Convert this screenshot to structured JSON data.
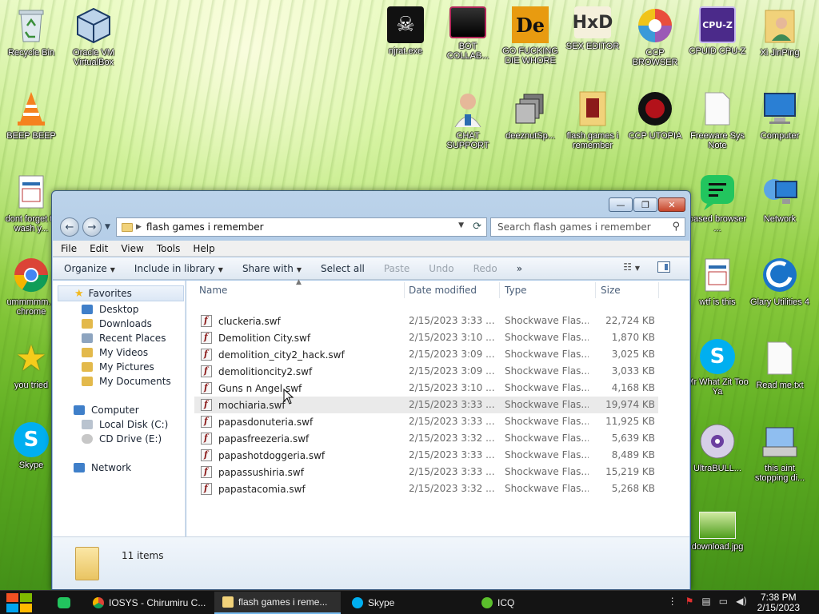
{
  "desktop": {
    "icons": [
      {
        "label": "Recycle Bin",
        "icon": "recycle-bin-icon"
      },
      {
        "label": "Oracle VM VirtualBox",
        "icon": "virtualbox-icon"
      },
      {
        "label": "njrat.exe",
        "icon": "skull-icon"
      },
      {
        "label": "BOT COLLAB...",
        "icon": "bot-collab-icon"
      },
      {
        "label": "GO FUCKING DIE WHORE",
        "icon": "de-icon"
      },
      {
        "label": "SEX EDITOR",
        "icon": "hxd-icon"
      },
      {
        "label": "CCP BROWSER",
        "icon": "browser-icon"
      },
      {
        "label": "CPUID CPU-Z",
        "icon": "cpuz-icon"
      },
      {
        "label": "Xi JinPing",
        "icon": "user-folder-icon"
      },
      {
        "label": "BEEP BEEP",
        "icon": "vlc-icon"
      },
      {
        "label": "CHAT SUPPORT",
        "icon": "doctor-icon"
      },
      {
        "label": "deeznutSp...",
        "icon": "stack-icon"
      },
      {
        "label": "flash games i remember",
        "icon": "folder-icon"
      },
      {
        "label": "CCP UTOPIA",
        "icon": "ccp-utopia-icon"
      },
      {
        "label": "Freeware Sys Note",
        "icon": "document-icon"
      },
      {
        "label": "Computer",
        "icon": "computer-icon"
      },
      {
        "label": "dont forget to wash y...",
        "icon": "calendar-file-icon"
      },
      {
        "label": "based browser ...",
        "icon": "based-browser-icon"
      },
      {
        "label": "Network",
        "icon": "network-icon"
      },
      {
        "label": "ummmmm... chrome",
        "icon": "chrome-icon"
      },
      {
        "label": "wtf is this",
        "icon": "calendar-file-icon"
      },
      {
        "label": "Glary Utilities 4",
        "icon": "glary-icon"
      },
      {
        "label": "you tried",
        "icon": "star-icon"
      },
      {
        "label": "Mr What Zit Too Ya",
        "icon": "skype-icon"
      },
      {
        "label": "Read me.txt",
        "icon": "text-file-icon"
      },
      {
        "label": "Skype",
        "icon": "skype-icon"
      },
      {
        "label": "UltraBULL...",
        "icon": "disc-icon"
      },
      {
        "label": "this aint stopping di...",
        "icon": "installer-icon"
      },
      {
        "label": "download.jpg",
        "icon": "image-icon"
      }
    ]
  },
  "window": {
    "title_controls": {
      "minimize": "—",
      "maximize": "❐",
      "close": "✕"
    },
    "address": {
      "path": "flash games i remember"
    },
    "search": {
      "placeholder": "Search flash games i remember"
    },
    "menu": [
      "File",
      "Edit",
      "View",
      "Tools",
      "Help"
    ],
    "toolbar": {
      "organize": "Organize",
      "include": "Include in library",
      "share": "Share with",
      "select_all": "Select all",
      "paste": "Paste",
      "undo": "Undo",
      "redo": "Redo",
      "more": "»"
    },
    "nav": {
      "favorites": "Favorites",
      "desktop": "Desktop",
      "downloads": "Downloads",
      "recent": "Recent Places",
      "videos": "My Videos",
      "pictures": "My Pictures",
      "documents": "My Documents",
      "computer": "Computer",
      "local_disk": "Local Disk (C:)",
      "cd_drive": "CD Drive (E:)",
      "network": "Network"
    },
    "columns": {
      "name": "Name",
      "date": "Date modified",
      "type": "Type",
      "size": "Size"
    },
    "files": [
      {
        "name": "cluckeria.swf",
        "date": "2/15/2023 3:33 ...",
        "type": "Shockwave Flas...",
        "size": "22,724 KB"
      },
      {
        "name": "Demolition City.swf",
        "date": "2/15/2023 3:10 ...",
        "type": "Shockwave Flas...",
        "size": "1,870 KB"
      },
      {
        "name": "demolition_city2_hack.swf",
        "date": "2/15/2023 3:09 ...",
        "type": "Shockwave Flas...",
        "size": "3,025 KB"
      },
      {
        "name": "demolitioncity2.swf",
        "date": "2/15/2023 3:09 ...",
        "type": "Shockwave Flas...",
        "size": "3,033 KB"
      },
      {
        "name": "Guns n Angel.swf",
        "date": "2/15/2023 3:10 ...",
        "type": "Shockwave Flas...",
        "size": "4,168 KB"
      },
      {
        "name": "mochiaria.swf",
        "date": "2/15/2023 3:33 ...",
        "type": "Shockwave Flas...",
        "size": "19,974 KB"
      },
      {
        "name": "papasdonuteria.swf",
        "date": "2/15/2023 3:33 ...",
        "type": "Shockwave Flas...",
        "size": "11,925 KB"
      },
      {
        "name": "papasfreezeria.swf",
        "date": "2/15/2023 3:32 ...",
        "type": "Shockwave Flas...",
        "size": "5,639 KB"
      },
      {
        "name": "papashotdoggeria.swf",
        "date": "2/15/2023 3:33 ...",
        "type": "Shockwave Flas...",
        "size": "8,489 KB"
      },
      {
        "name": "papassushiria.swf",
        "date": "2/15/2023 3:33 ...",
        "type": "Shockwave Flas...",
        "size": "15,219 KB"
      },
      {
        "name": "papastacomia.swf",
        "date": "2/15/2023 3:32 ...",
        "type": "Shockwave Flas...",
        "size": "5,268 KB"
      }
    ],
    "status": {
      "item_count": "11 items"
    }
  },
  "taskbar": {
    "items": [
      {
        "label": "IOSYS - Chirumiru C...",
        "icon": "chrome-icon"
      },
      {
        "label": "flash games i reme...",
        "icon": "folder-icon"
      },
      {
        "label": "Skype",
        "icon": "skype-icon"
      },
      {
        "label": "ICQ",
        "icon": "icq-icon"
      }
    ],
    "clock": {
      "time": "7:38 PM",
      "date": "2/15/2023"
    }
  },
  "colors": {
    "accent": "#76b9ed",
    "window_frame": "#a5c3e2",
    "selection": "#eaeaea"
  }
}
